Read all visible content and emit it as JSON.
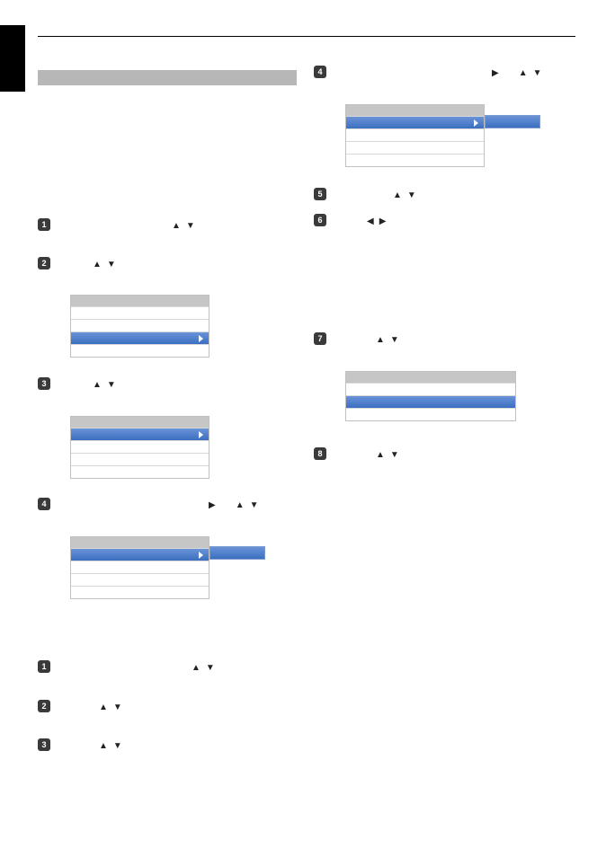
{
  "steps": {
    "s1": "1",
    "s2": "2",
    "s3": "3",
    "s4": "4",
    "s5": "5",
    "s6": "6",
    "s7": "7",
    "s8": "8"
  },
  "glyphs": {
    "up": "▲",
    "down": "▼",
    "left": "◀",
    "right": "▶"
  }
}
